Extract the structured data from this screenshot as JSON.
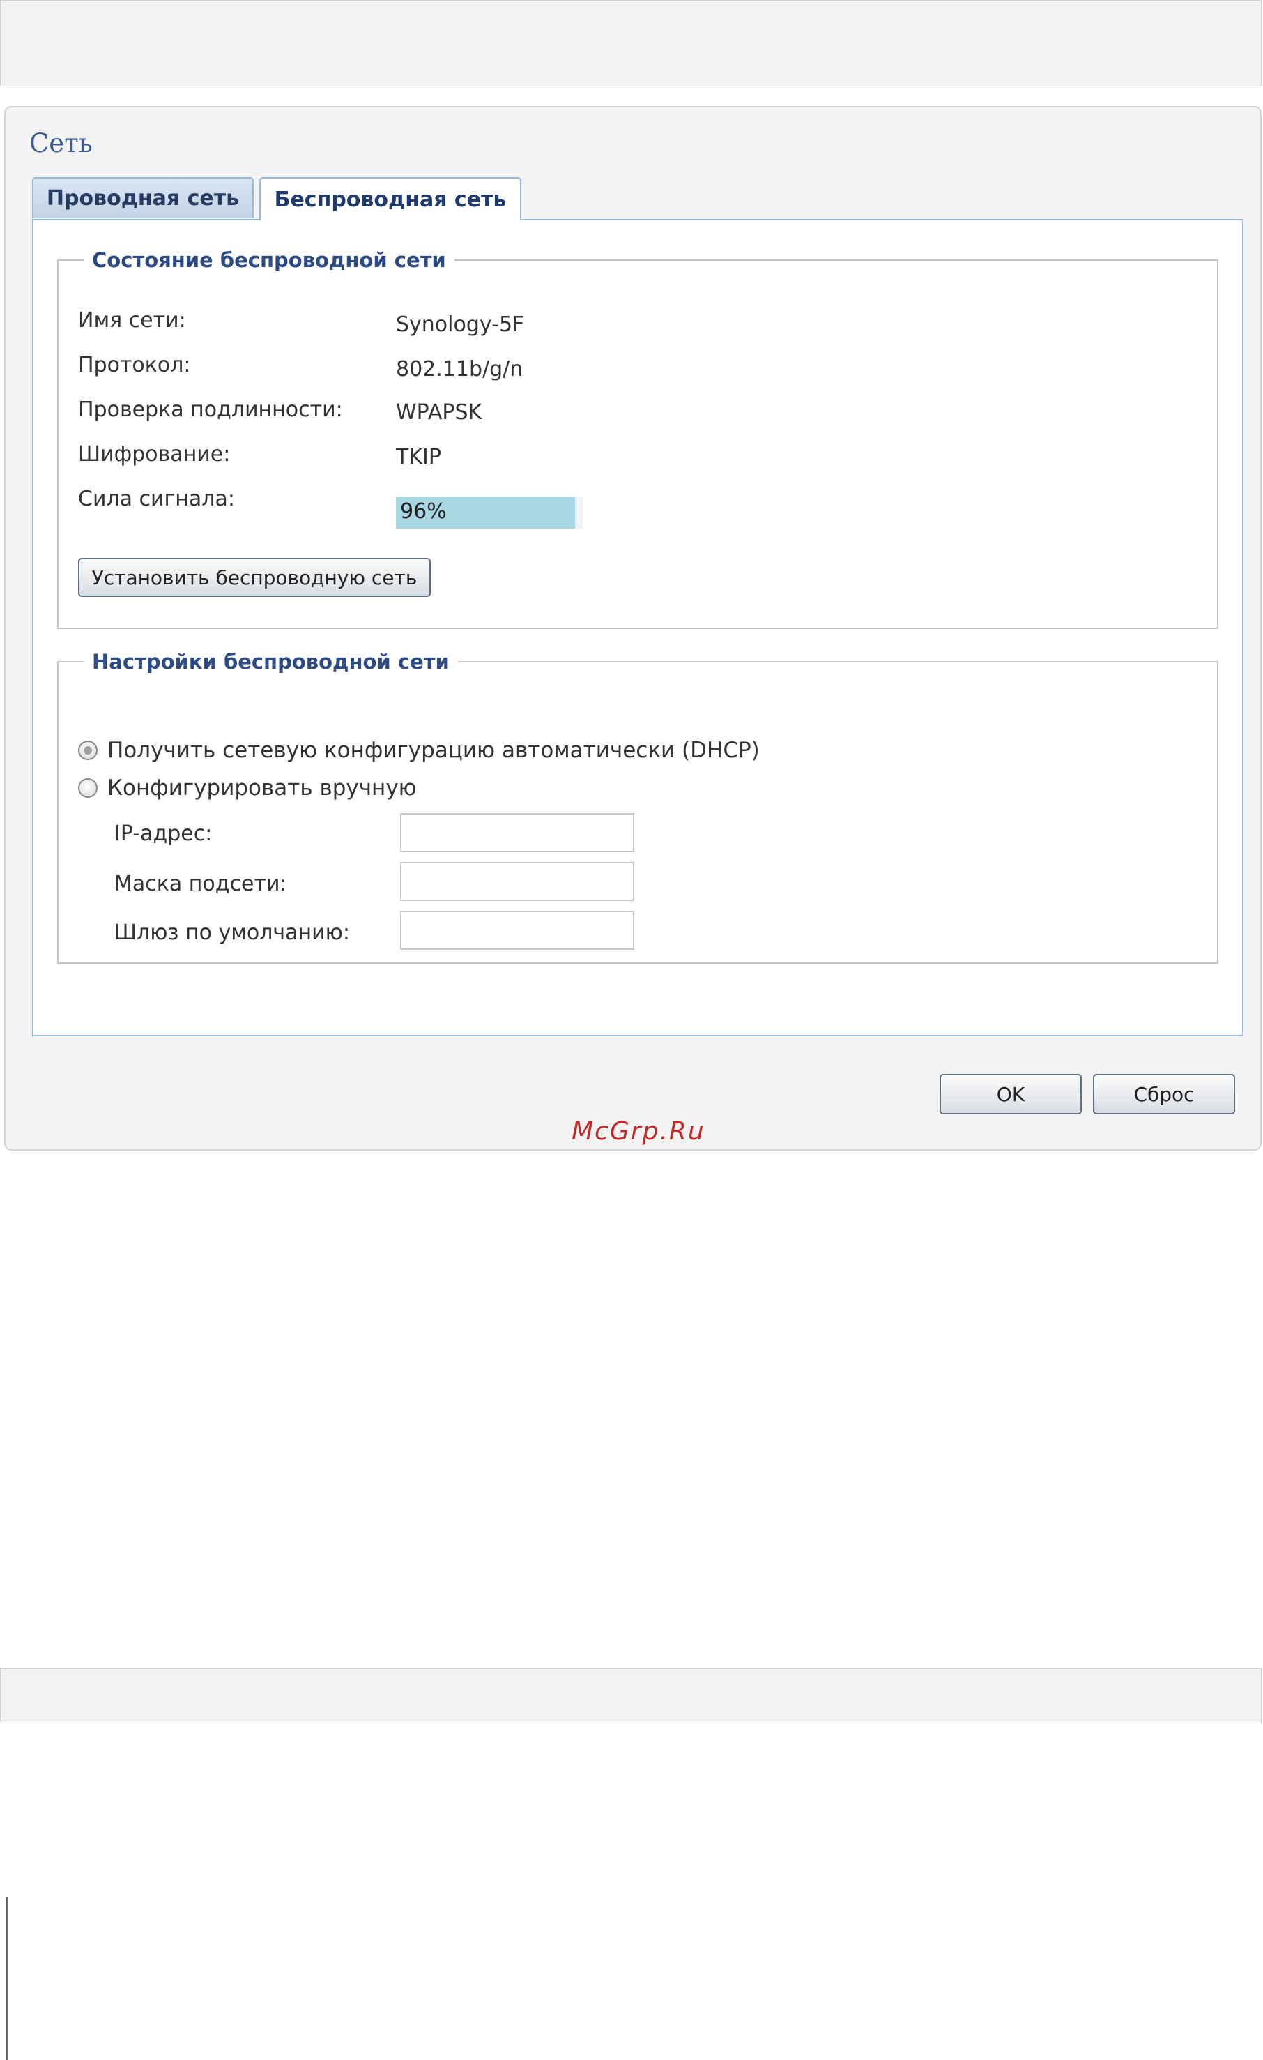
{
  "window": {
    "title": "Сеть"
  },
  "tabs": [
    {
      "label": "Проводная сеть",
      "active": false
    },
    {
      "label": "Беспроводная сеть",
      "active": true
    }
  ],
  "status": {
    "legend": "Состояние беспроводной сети",
    "rows": [
      {
        "label": "Имя сети:",
        "value": "Synology-5F"
      },
      {
        "label": "Протокол:",
        "value": "802.11b/g/n"
      },
      {
        "label": "Проверка подлинности:",
        "value": "WPAPSK"
      },
      {
        "label": "Шифрование:",
        "value": "TKIP"
      },
      {
        "label": "Сила сигнала:",
        "value": "96%"
      }
    ],
    "signal_fraction": 0.96,
    "setup_button": "Установить беспроводную сеть"
  },
  "settings": {
    "legend": "Настройки беспроводной сети",
    "radio_dhcp": "Получить сетевую конфигурацию автоматически (DHCP)",
    "radio_manual": "Конфигурировать вручную",
    "selected": "dhcp",
    "fields": [
      {
        "label": "IP-адрес:",
        "value": ""
      },
      {
        "label": "Маска подсети:",
        "value": ""
      },
      {
        "label": "Шлюз по умолчанию:",
        "value": ""
      }
    ]
  },
  "footer": {
    "ok_label": "OK",
    "reset_label": "Сброс"
  },
  "watermark": "McGrp.Ru",
  "colors": {
    "title": "#3a5a92",
    "legend": "#2b4a86",
    "tab_border": "#9cb8d8",
    "signal_fill": "#a9d6e3",
    "watermark": "#c62828"
  }
}
